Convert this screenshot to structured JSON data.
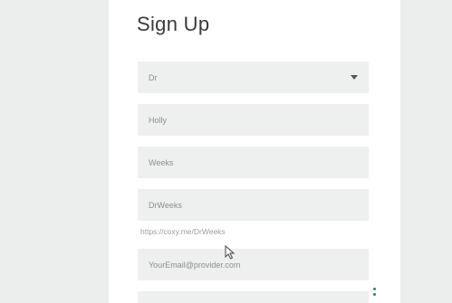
{
  "form": {
    "title": "Sign Up",
    "title_select": {
      "value": "Dr"
    },
    "first_name": {
      "value": "Holly"
    },
    "last_name": {
      "value": "Weeks"
    },
    "username": {
      "value": "DrWeeks"
    },
    "profile_url": "https://coxy.me/DrWeeks",
    "email": {
      "placeholder": "YourEmail@provider.com"
    }
  },
  "icons": {
    "dropdown": "chevron-down-icon",
    "cursor": "mouse-pointer-icon",
    "menu": "kebab-menu-icon"
  },
  "colors": {
    "page_bg": "#eceeee",
    "card_bg": "#ffffff",
    "field_bg": "#eef0f0",
    "text": "#3a3a3a",
    "accent": "#2a8a4a"
  }
}
